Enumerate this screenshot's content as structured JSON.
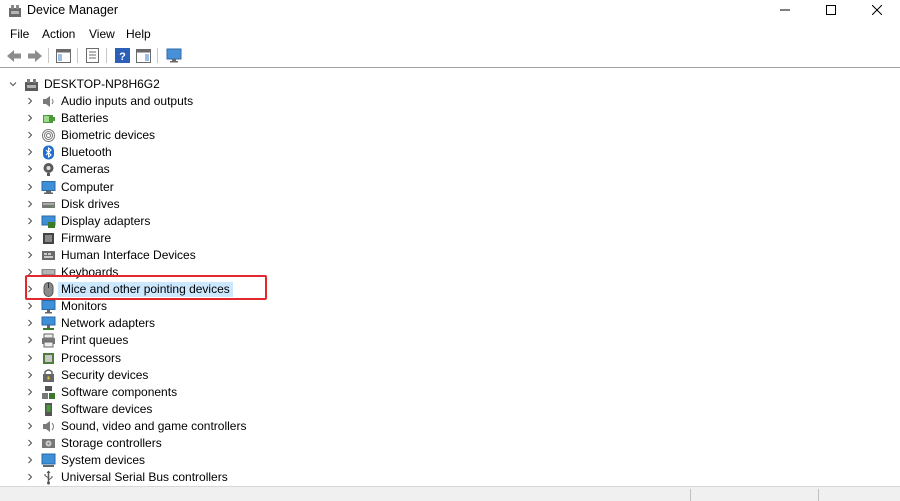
{
  "window": {
    "title": "Device Manager",
    "controls": [
      "minimize",
      "maximize",
      "close"
    ]
  },
  "menu": {
    "items": [
      "File",
      "Action",
      "View",
      "Help"
    ]
  },
  "toolbar": {
    "buttons": [
      "back-arrow-icon",
      "forward-arrow-icon",
      "properties-icon",
      "show-hide-console-tree-icon",
      "help-icon",
      "refresh-icon",
      "computer-monitor-icon"
    ]
  },
  "tree": {
    "root": "DESKTOP-NP8H6G2",
    "items": [
      {
        "label": "Audio inputs and outputs",
        "icon": "speaker-icon"
      },
      {
        "label": "Batteries",
        "icon": "battery-icon"
      },
      {
        "label": "Biometric devices",
        "icon": "fingerprint-icon"
      },
      {
        "label": "Bluetooth",
        "icon": "bluetooth-icon"
      },
      {
        "label": "Cameras",
        "icon": "camera-icon"
      },
      {
        "label": "Computer",
        "icon": "computer-icon"
      },
      {
        "label": "Disk drives",
        "icon": "disk-drive-icon"
      },
      {
        "label": "Display adapters",
        "icon": "display-adapter-icon"
      },
      {
        "label": "Firmware",
        "icon": "firmware-icon"
      },
      {
        "label": "Human Interface Devices",
        "icon": "hid-icon"
      },
      {
        "label": "Keyboards",
        "icon": "keyboard-icon"
      },
      {
        "label": "Mice and other pointing devices",
        "icon": "mouse-icon"
      },
      {
        "label": "Monitors",
        "icon": "monitor-icon"
      },
      {
        "label": "Network adapters",
        "icon": "network-adapter-icon"
      },
      {
        "label": "Print queues",
        "icon": "printer-icon"
      },
      {
        "label": "Processors",
        "icon": "processor-icon"
      },
      {
        "label": "Security devices",
        "icon": "security-device-icon"
      },
      {
        "label": "Software components",
        "icon": "software-component-icon"
      },
      {
        "label": "Software devices",
        "icon": "software-device-icon"
      },
      {
        "label": "Sound, video and game controllers",
        "icon": "sound-controller-icon"
      },
      {
        "label": "Storage controllers",
        "icon": "storage-controller-icon"
      },
      {
        "label": "System devices",
        "icon": "system-device-icon"
      },
      {
        "label": "Universal Serial Bus controllers",
        "icon": "usb-icon"
      }
    ],
    "selected_label": "Mice and other pointing devices"
  },
  "colors": {
    "selection": "#cce8ff",
    "highlight_border": "#e0282e"
  }
}
